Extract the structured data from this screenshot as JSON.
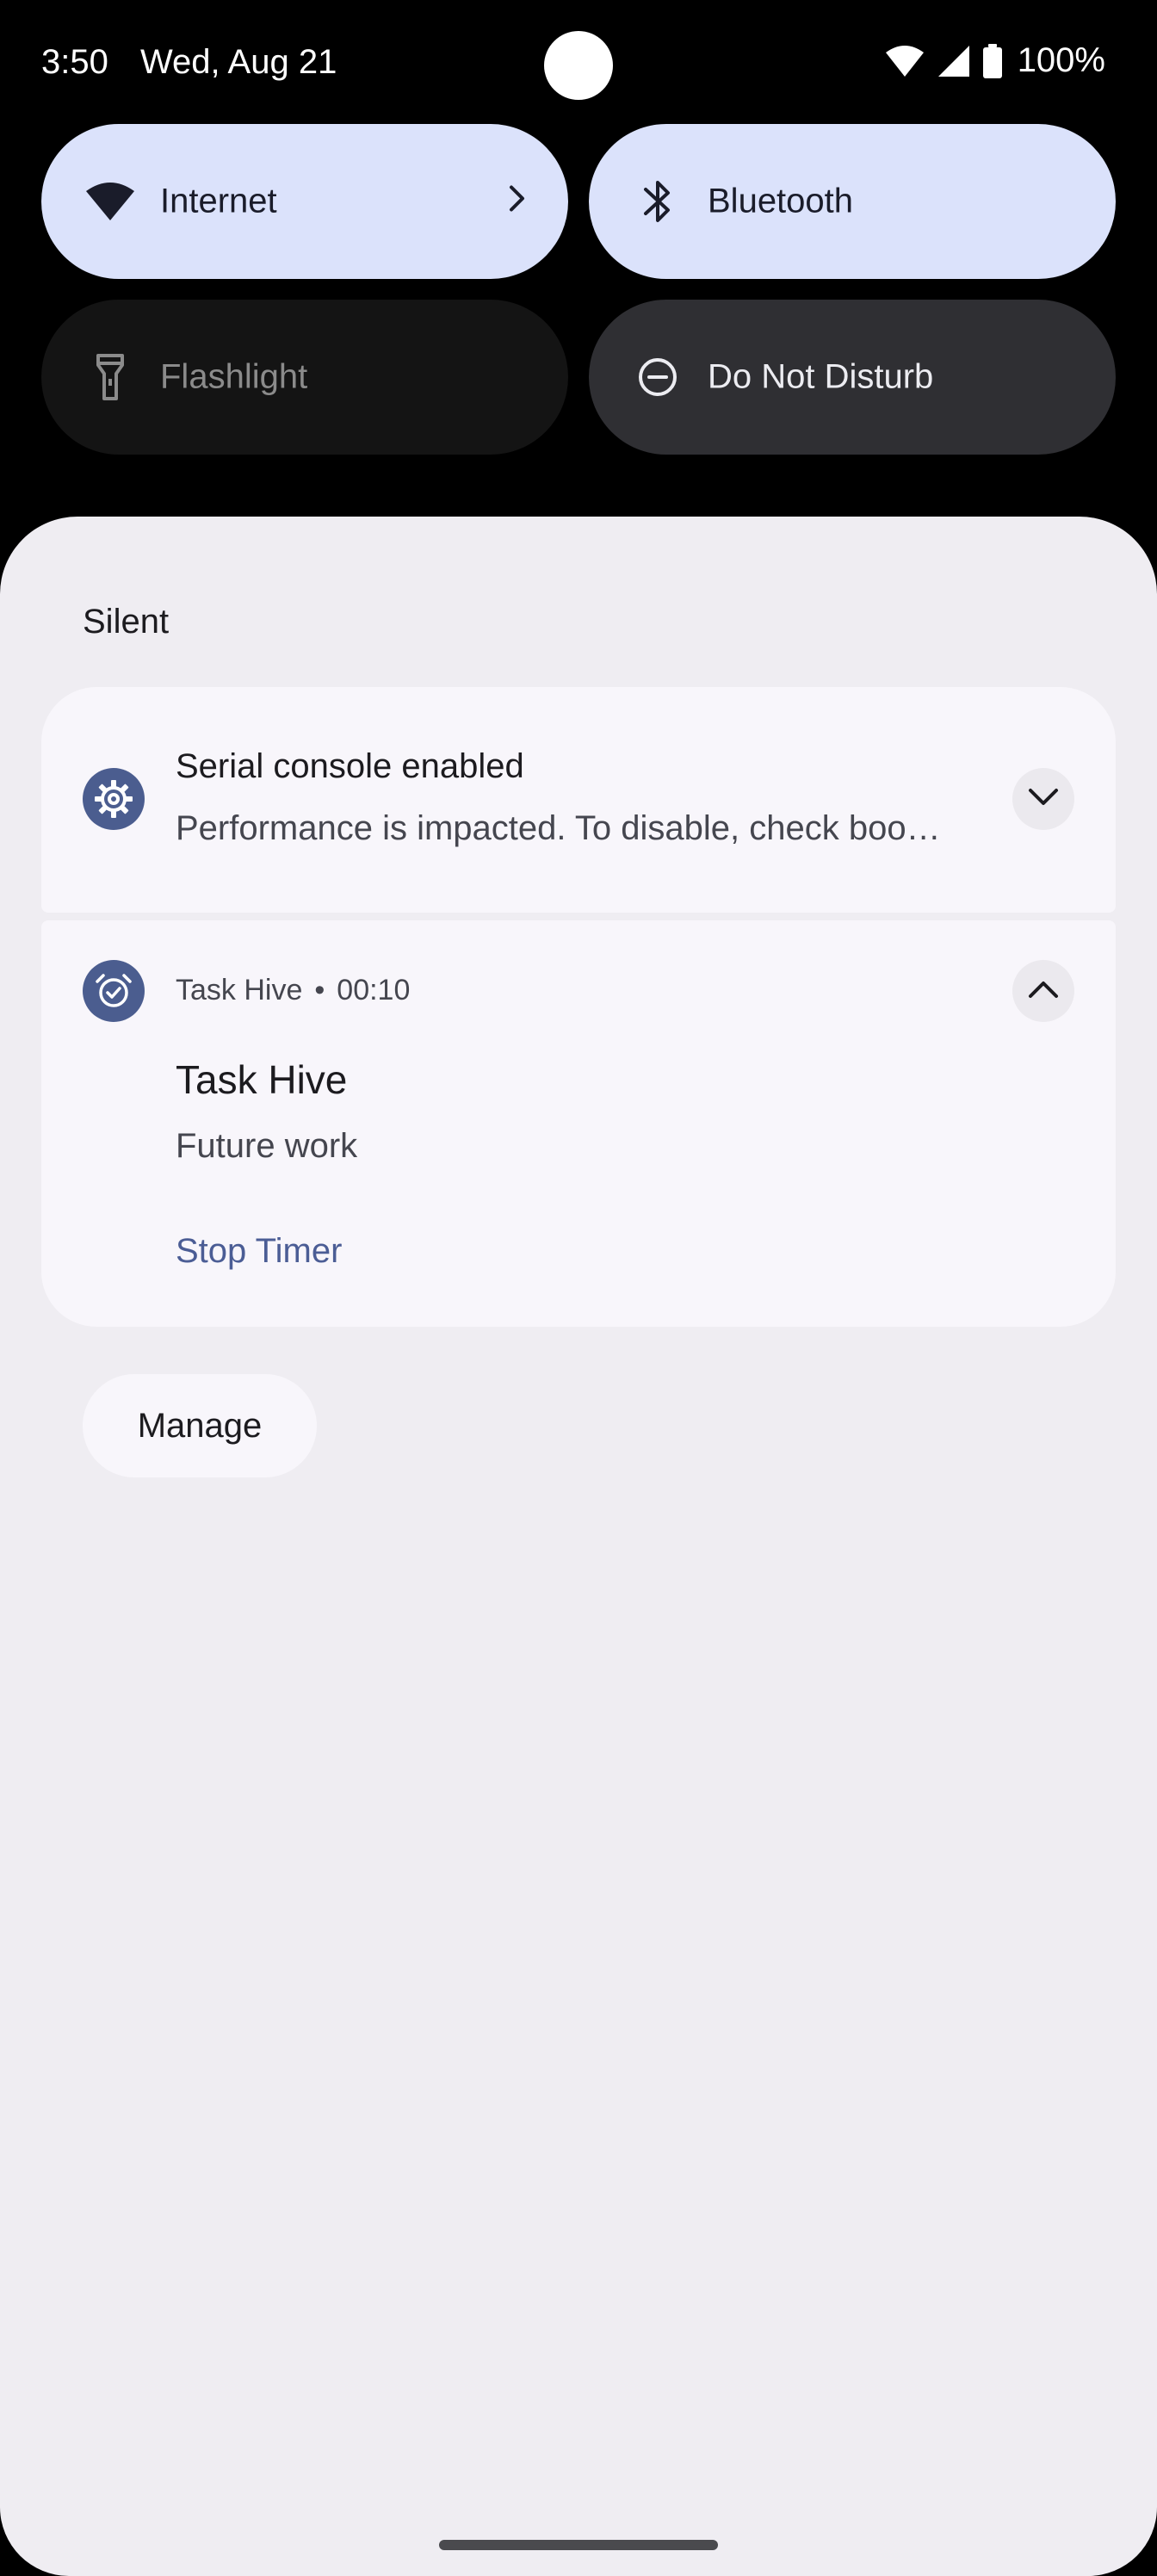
{
  "status_bar": {
    "time": "3:50",
    "date": "Wed, Aug 21",
    "battery": "100%",
    "icons": [
      "wifi-icon",
      "signal-icon",
      "battery-icon"
    ]
  },
  "quick_settings": {
    "tiles": [
      {
        "label": "Internet",
        "icon": "wifi-icon",
        "state": "on"
      },
      {
        "label": "Bluetooth",
        "icon": "bluetooth-icon",
        "state": "on"
      },
      {
        "label": "Flashlight",
        "icon": "flashlight-icon",
        "state": "unavailable"
      },
      {
        "label": "Do Not Disturb",
        "icon": "dnd-icon",
        "state": "off"
      }
    ]
  },
  "shade": {
    "section_title": "Silent",
    "notifications": [
      {
        "icon": "gear-icon",
        "title": "Serial console enabled",
        "text": "Performance is impacted. To disable, check boo…"
      },
      {
        "icon": "alarm-icon",
        "app": "Task Hive",
        "time": "00:10",
        "title": "Task Hive",
        "text": "Future work",
        "action": "Stop Timer"
      }
    ],
    "manage_label": "Manage"
  },
  "colors": {
    "tile_active": "#dbe2fb",
    "shade_bg": "#efedf2",
    "card_bg": "#f8f6fb",
    "accent": "#4b5d8f"
  }
}
